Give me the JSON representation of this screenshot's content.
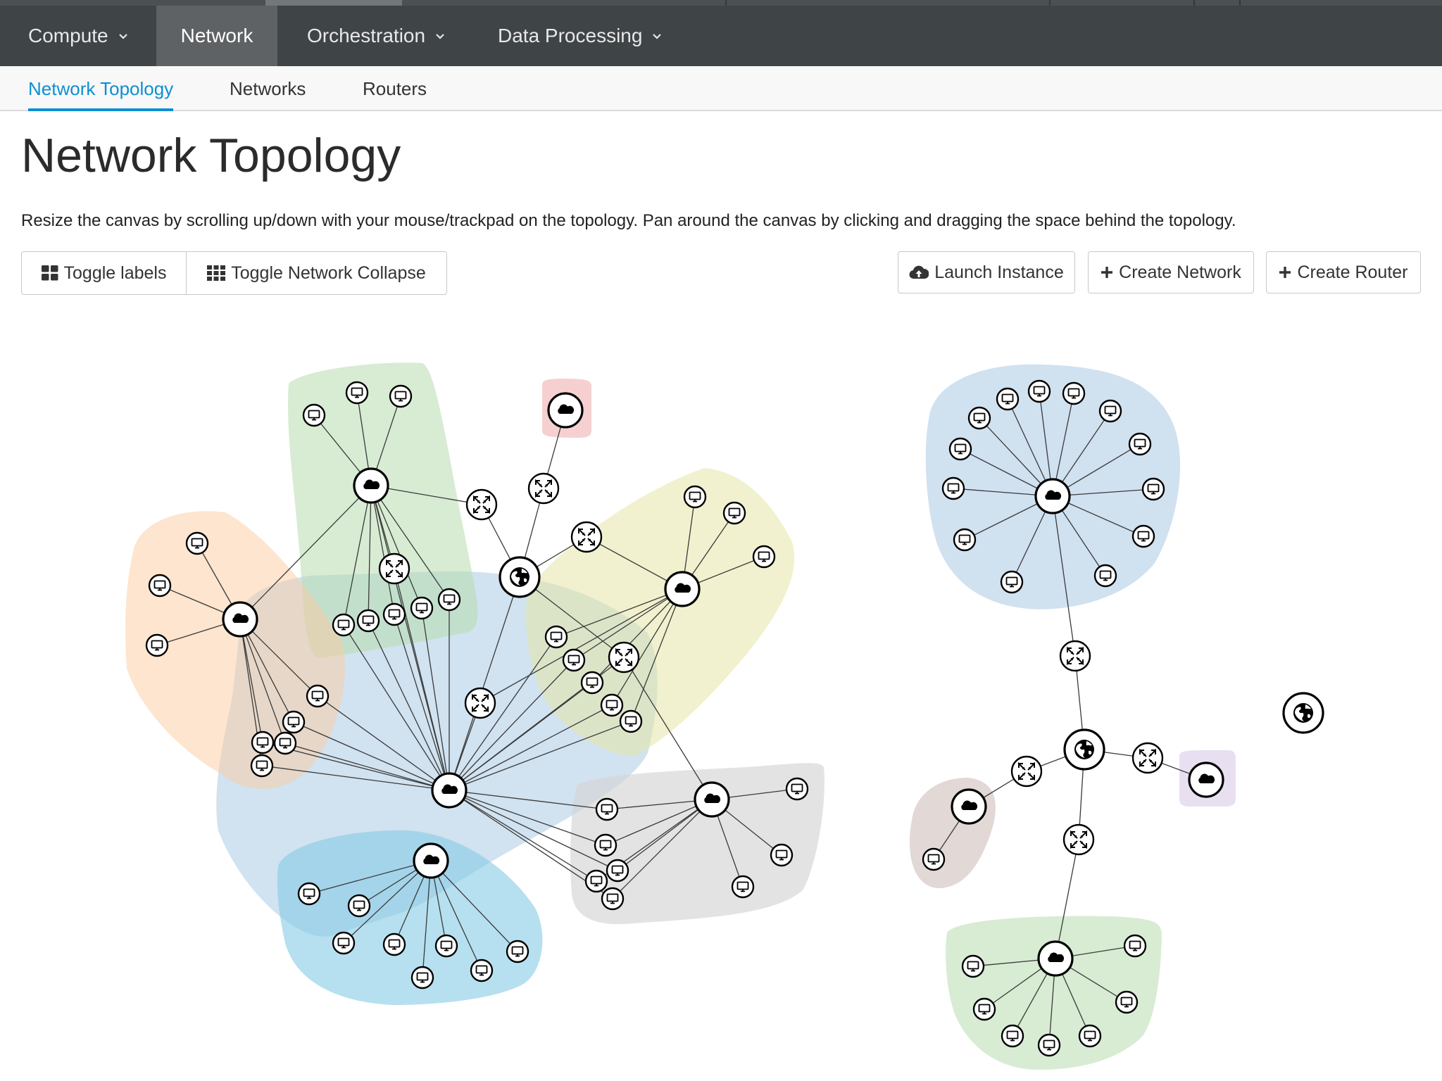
{
  "topnav": {
    "items": [
      {
        "label": "Compute",
        "dropdown": true
      },
      {
        "label": "Network",
        "active": true
      },
      {
        "label": "Orchestration",
        "dropdown": true
      },
      {
        "label": "Data Processing",
        "dropdown": true
      }
    ]
  },
  "subnav": {
    "tabs": [
      {
        "label": "Network Topology",
        "active": true
      },
      {
        "label": "Networks"
      },
      {
        "label": "Routers"
      }
    ]
  },
  "page": {
    "title": "Network Topology",
    "help": "Resize the canvas by scrolling up/down with your mouse/trackpad on the topology. Pan around the canvas by clicking and dragging the space behind the topology."
  },
  "actions": {
    "toggle_labels": "Toggle labels",
    "toggle_collapse": "Toggle Network Collapse",
    "launch_instance": "Launch Instance",
    "create_network": "Create Network",
    "create_router": "Create Router"
  },
  "colors": {
    "accent": "#0d8fd3",
    "navbar": "#3f4447",
    "nav_active": "#5e6265"
  },
  "topology": {
    "networks": [
      {
        "id": "net-green-top",
        "color": "#b6dcae"
      },
      {
        "id": "net-orange",
        "color": "#fccca0"
      },
      {
        "id": "net-blue-main",
        "color": "#b3cfe6"
      },
      {
        "id": "net-yellow",
        "color": "#e6e6a8"
      },
      {
        "id": "net-red",
        "color": "#eea9ab"
      },
      {
        "id": "net-teal",
        "color": "#86cbe4"
      },
      {
        "id": "net-gray",
        "color": "#d4d4d4"
      },
      {
        "id": "net-blue-right",
        "color": "#a9c9e4"
      },
      {
        "id": "net-brown",
        "color": "#cbb8b5"
      },
      {
        "id": "net-purple",
        "color": "#d8cce8"
      },
      {
        "id": "net-green-bottom",
        "color": "#b6dcae"
      }
    ],
    "node_types": [
      "network-cloud",
      "router",
      "external-gateway",
      "instance"
    ]
  }
}
